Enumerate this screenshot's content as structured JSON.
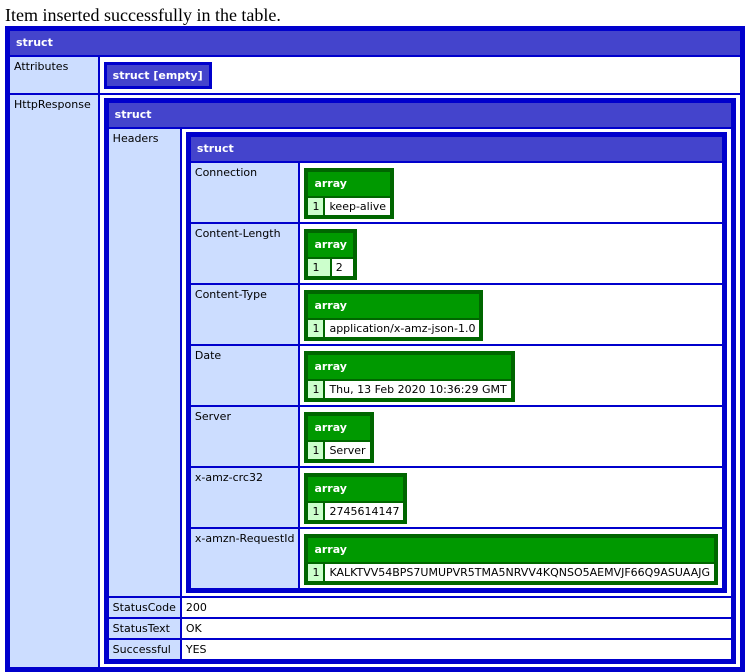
{
  "message": "Item inserted successfully in the table.",
  "dump": {
    "type_label": "struct",
    "attributes": {
      "key": "Attributes",
      "value": "struct [empty]"
    },
    "http_response": {
      "key": "HttpResponse",
      "type_label": "struct",
      "headers": {
        "key": "Headers",
        "type_label": "struct",
        "items": [
          {
            "key": "Connection",
            "type_label": "array",
            "index": "1",
            "value": "keep-alive"
          },
          {
            "key": "Content-Length",
            "type_label": "array",
            "index": "1",
            "value": "2"
          },
          {
            "key": "Content-Type",
            "type_label": "array",
            "index": "1",
            "value": "application/x-amz-json-1.0"
          },
          {
            "key": "Date",
            "type_label": "array",
            "index": "1",
            "value": "Thu, 13 Feb 2020 10:36:29 GMT"
          },
          {
            "key": "Server",
            "type_label": "array",
            "index": "1",
            "value": "Server"
          },
          {
            "key": "x-amz-crc32",
            "type_label": "array",
            "index": "1",
            "value": "2745614147"
          },
          {
            "key": "x-amzn-RequestId",
            "type_label": "array",
            "index": "1",
            "value": "KALKTVV54BPS7UMUPVR5TMA5NRVV4KQNSO5AEMVJF66Q9ASUAAJG"
          }
        ]
      },
      "status_code": {
        "key": "StatusCode",
        "value": "200"
      },
      "status_text": {
        "key": "StatusText",
        "value": "OK"
      },
      "successful": {
        "key": "Successful",
        "value": "YES"
      }
    }
  },
  "colors": {
    "struct_border": "#0000cc",
    "struct_header": "#4444cc",
    "struct_key": "#ccddff",
    "array_border": "#006600",
    "array_header": "#009900",
    "array_index": "#ccffcc"
  }
}
